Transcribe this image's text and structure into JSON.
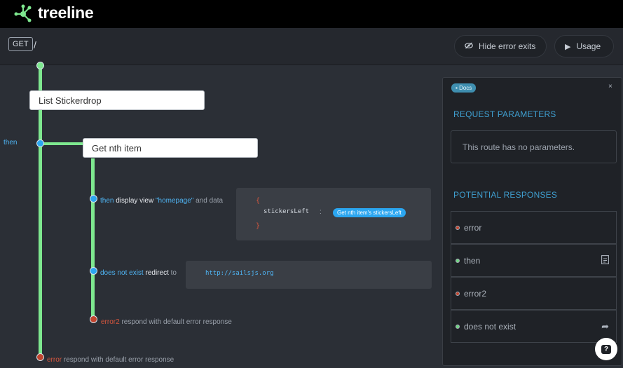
{
  "app": {
    "name": "treeline"
  },
  "route": {
    "method": "GET",
    "path": "/"
  },
  "toolbar": {
    "hide_errors_label": "Hide error exits",
    "usage_label": "Usage"
  },
  "flow": {
    "card1": "List Stickerdrop",
    "then_label": "then",
    "card2": "Get nth item",
    "exit_then": {
      "kw": "then",
      "action": "display view",
      "view": "\"homepage\"",
      "suffix": "and data"
    },
    "code": {
      "open": "{",
      "key": "stickersLeft",
      "colon": ":",
      "pill": "Get nth item's stickersLeft",
      "close": "}"
    },
    "exit_notexist": {
      "kw": "does not exist",
      "action": "redirect",
      "suffix": "to"
    },
    "redirect_url": "http://sailsjs.org",
    "exit_error2": {
      "kw": "error2",
      "rest": "respond with default error response"
    },
    "exit_error": {
      "kw": "error",
      "rest": "respond with default error response"
    }
  },
  "docs": {
    "tag": "Docs",
    "close": "×",
    "request_params_heading": "REQUEST PARAMETERS",
    "no_params": "This route has no parameters.",
    "responses_heading": "POTENTIAL RESPONSES",
    "responses": [
      {
        "label": "error",
        "color": "#c1442e",
        "icon": ""
      },
      {
        "label": "then",
        "color": "#6fd882",
        "icon": "page-icon"
      },
      {
        "label": "error2",
        "color": "#c1442e",
        "icon": ""
      },
      {
        "label": "does not exist",
        "color": "#6fd882",
        "icon": "redirect-arrow-icon"
      }
    ]
  },
  "help": {
    "label": "?"
  },
  "colors": {
    "wire": "#7ee88f",
    "accent": "#2ba6f0",
    "error": "#c1442e",
    "heading": "#3f9fd0"
  }
}
